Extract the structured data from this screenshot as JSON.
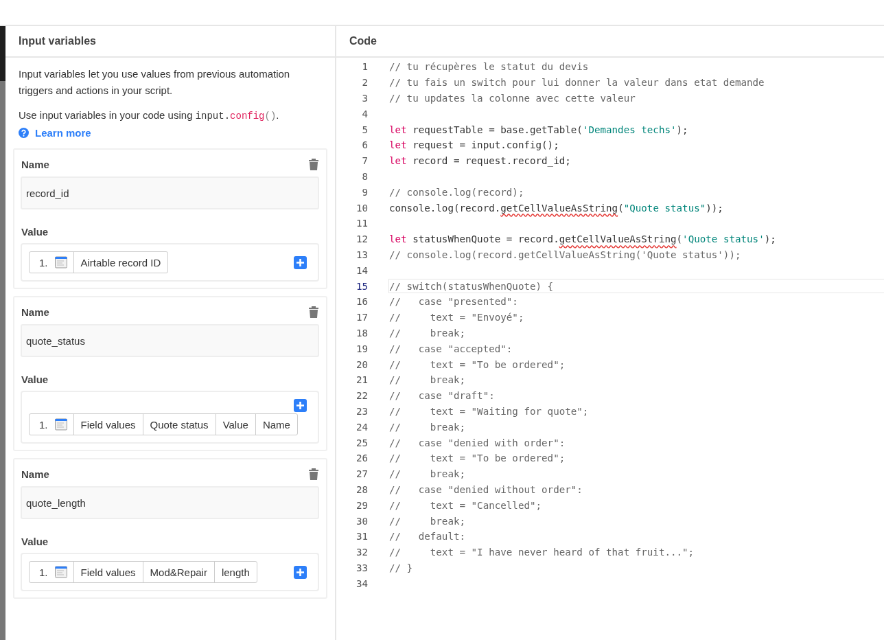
{
  "input_panel": {
    "title": "Input variables",
    "description": "Input variables let you use values from previous automation triggers and actions in your script.",
    "usage": [
      {
        "kind": "text",
        "text": "Use input variables in your code using "
      },
      {
        "kind": "code",
        "text": "input."
      },
      {
        "kind": "code-accent",
        "text": "config"
      },
      {
        "kind": "code-muted",
        "text": "()"
      },
      {
        "kind": "text",
        "text": "."
      }
    ],
    "learn_more": "Learn more",
    "variables": [
      {
        "name_label": "Name",
        "name": "record_id",
        "value_label": "Value",
        "index": "1.",
        "segments": [
          "Airtable record ID"
        ]
      },
      {
        "name_label": "Name",
        "name": "quote_status",
        "value_label": "Value",
        "index": "1.",
        "segments": [
          "Field values",
          "Quote status",
          "Value",
          "Name"
        ]
      },
      {
        "name_label": "Name",
        "name": "quote_length",
        "value_label": "Value",
        "index": "1.",
        "segments": [
          "Field values",
          "Mod&Repair",
          "length"
        ]
      }
    ]
  },
  "code_panel": {
    "title": "Code",
    "lines": [
      {
        "number": "1",
        "active": false,
        "tokens": [
          {
            "kind": "comment",
            "text": "// tu récupères le statut du devis"
          }
        ]
      },
      {
        "number": "2",
        "active": false,
        "tokens": [
          {
            "kind": "comment",
            "text": "// tu fais un switch pour lui donner la valeur dans etat demande"
          }
        ]
      },
      {
        "number": "3",
        "active": false,
        "tokens": [
          {
            "kind": "comment",
            "text": "// tu updates la colonne avec cette valeur"
          }
        ]
      },
      {
        "number": "4",
        "active": false
      },
      {
        "number": "5",
        "active": false,
        "tokens": [
          {
            "kind": "keyword",
            "text": "let"
          },
          {
            "kind": "plain",
            "text": " requestTable = base.getTable("
          },
          {
            "kind": "string",
            "text": "'Demandes techs'"
          },
          {
            "kind": "plain",
            "text": ");"
          }
        ]
      },
      {
        "number": "6",
        "active": false,
        "tokens": [
          {
            "kind": "keyword",
            "text": "let"
          },
          {
            "kind": "plain",
            "text": " request = input.config();"
          }
        ]
      },
      {
        "number": "7",
        "active": false,
        "tokens": [
          {
            "kind": "keyword",
            "text": "let"
          },
          {
            "kind": "plain",
            "text": " record = request.record_id;"
          }
        ]
      },
      {
        "number": "8",
        "active": false
      },
      {
        "number": "9",
        "active": false,
        "tokens": [
          {
            "kind": "comment",
            "text": "// console.log(record);"
          }
        ]
      },
      {
        "number": "10",
        "active": false,
        "tokens": [
          {
            "kind": "plain",
            "text": "console.log(record."
          },
          {
            "kind": "error",
            "text": "getCellValueAsString"
          },
          {
            "kind": "plain",
            "text": "("
          },
          {
            "kind": "string",
            "text": "\"Quote status\""
          },
          {
            "kind": "plain",
            "text": "));"
          }
        ]
      },
      {
        "number": "11",
        "active": false
      },
      {
        "number": "12",
        "active": false,
        "tokens": [
          {
            "kind": "keyword",
            "text": "let"
          },
          {
            "kind": "plain",
            "text": " statusWhenQuote = record."
          },
          {
            "kind": "error",
            "text": "getCellValueAsString"
          },
          {
            "kind": "plain",
            "text": "("
          },
          {
            "kind": "string",
            "text": "'Quote status'"
          },
          {
            "kind": "plain",
            "text": ");"
          }
        ]
      },
      {
        "number": "13",
        "active": false,
        "tokens": [
          {
            "kind": "comment",
            "text": "// console.log(record.getCellValueAsString('Quote status'));"
          }
        ]
      },
      {
        "number": "14",
        "active": false
      },
      {
        "number": "15",
        "active": true,
        "tokens": [
          {
            "kind": "comment",
            "text": "// switch(statusWhenQuote) {"
          }
        ]
      },
      {
        "number": "16",
        "active": false,
        "tokens": [
          {
            "kind": "comment",
            "text": "//   case \"presented\":"
          }
        ]
      },
      {
        "number": "17",
        "active": false,
        "tokens": [
          {
            "kind": "comment",
            "text": "//     text = \"Envoyé\";"
          }
        ]
      },
      {
        "number": "18",
        "active": false,
        "tokens": [
          {
            "kind": "comment",
            "text": "//     break;"
          }
        ]
      },
      {
        "number": "19",
        "active": false,
        "tokens": [
          {
            "kind": "comment",
            "text": "//   case \"accepted\":"
          }
        ]
      },
      {
        "number": "20",
        "active": false,
        "tokens": [
          {
            "kind": "comment",
            "text": "//     text = \"To be ordered\";"
          }
        ]
      },
      {
        "number": "21",
        "active": false,
        "tokens": [
          {
            "kind": "comment",
            "text": "//     break;"
          }
        ]
      },
      {
        "number": "22",
        "active": false,
        "tokens": [
          {
            "kind": "comment",
            "text": "//   case \"draft\":"
          }
        ]
      },
      {
        "number": "23",
        "active": false,
        "tokens": [
          {
            "kind": "comment",
            "text": "//     text = \"Waiting for quote\";"
          }
        ]
      },
      {
        "number": "24",
        "active": false,
        "tokens": [
          {
            "kind": "comment",
            "text": "//     break;"
          }
        ]
      },
      {
        "number": "25",
        "active": false,
        "tokens": [
          {
            "kind": "comment",
            "text": "//   case \"denied with order\":"
          }
        ]
      },
      {
        "number": "26",
        "active": false,
        "tokens": [
          {
            "kind": "comment",
            "text": "//     text = \"To be ordered\";"
          }
        ]
      },
      {
        "number": "27",
        "active": false,
        "tokens": [
          {
            "kind": "comment",
            "text": "//     break;"
          }
        ]
      },
      {
        "number": "28",
        "active": false,
        "tokens": [
          {
            "kind": "comment",
            "text": "//   case \"denied without order\":"
          }
        ]
      },
      {
        "number": "29",
        "active": false,
        "tokens": [
          {
            "kind": "comment",
            "text": "//     text = \"Cancelled\";"
          }
        ]
      },
      {
        "number": "30",
        "active": false,
        "tokens": [
          {
            "kind": "comment",
            "text": "//     break;"
          }
        ]
      },
      {
        "number": "31",
        "active": false,
        "tokens": [
          {
            "kind": "comment",
            "text": "//   default:"
          }
        ]
      },
      {
        "number": "32",
        "active": false,
        "tokens": [
          {
            "kind": "comment",
            "text": "//     text = \"I have never heard of that fruit...\";"
          }
        ]
      },
      {
        "number": "33",
        "active": false,
        "tokens": [
          {
            "kind": "comment",
            "text": "// }"
          }
        ]
      },
      {
        "number": "34",
        "active": false
      }
    ]
  }
}
